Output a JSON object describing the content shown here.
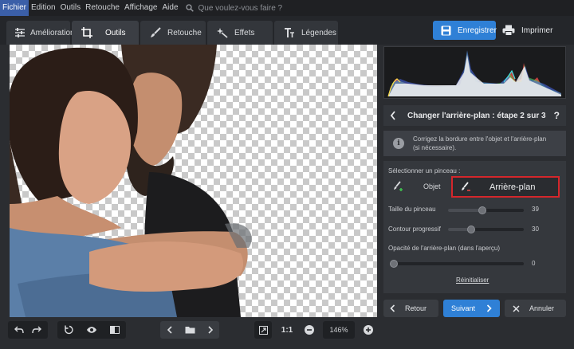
{
  "menu": {
    "items": [
      "Fichier",
      "Edition",
      "Outils",
      "Retouche",
      "Affichage",
      "Aide"
    ],
    "search_placeholder": "Que voulez-vous faire ?"
  },
  "tabs": [
    {
      "label": "Amélioration",
      "icon": "sliders-icon"
    },
    {
      "label": "Outils",
      "icon": "crop-icon"
    },
    {
      "label": "Retouche",
      "icon": "brush-icon"
    },
    {
      "label": "Effets",
      "icon": "magic-wand-icon"
    },
    {
      "label": "Légendes",
      "icon": "text-icon"
    }
  ],
  "actions": {
    "save": "Enregistrer",
    "print": "Imprimer"
  },
  "bottom": {
    "zoom_1to1": "1:1",
    "zoom": "146%"
  },
  "panel": {
    "step_title": "Changer l'arrière-plan : étape 2 sur 3",
    "help": "?",
    "info_line1": "Corrigez la bordure entre l'objet et l'arrière-plan",
    "info_line2": "(si nécessaire).",
    "select_brush": "Sélectionner un pinceau :",
    "brush_object": "Objet",
    "brush_background": "Arrière-plan",
    "brush_size_label": "Taille du pinceau",
    "brush_size_value": "39",
    "brush_size_level": 0.45,
    "feather_label": "Contour progressif",
    "feather_value": "30",
    "feather_level": 0.3,
    "opacity_label": "Opacité de l'arrière-plan (dans l'aperçu)",
    "opacity_value": "0",
    "opacity_level": 0.0,
    "reset": "Réinitialiser",
    "back": "Retour",
    "next": "Suivant",
    "cancel": "Annuler"
  },
  "colors": {
    "accent": "#2f80d6",
    "highlight": "#d4262b"
  }
}
